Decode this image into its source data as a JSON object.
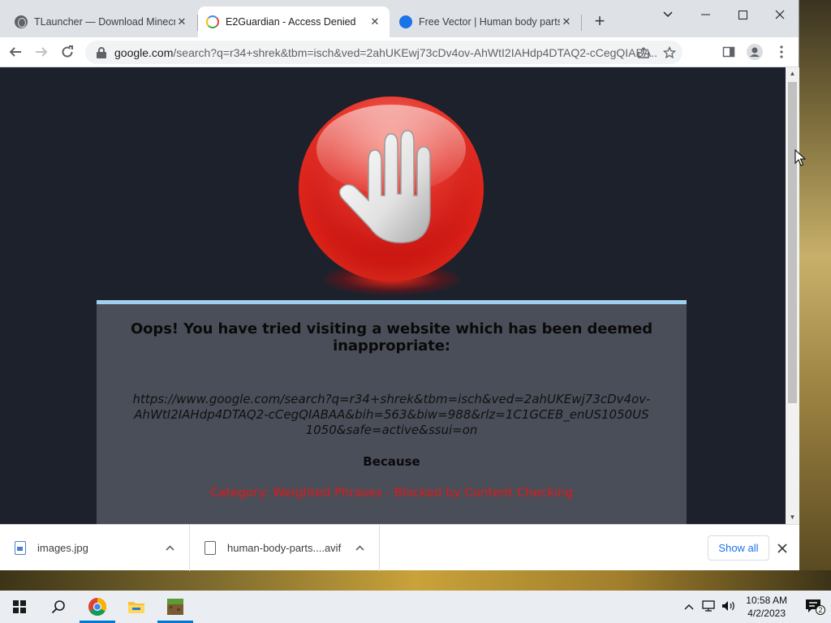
{
  "tabs": [
    {
      "title": "TLauncher — Download Minecraft",
      "favicon": "globe-icon",
      "active": false
    },
    {
      "title": "E2Guardian - Access Denied",
      "favicon": "google-g-icon",
      "active": true
    },
    {
      "title": "Free Vector | Human body parts",
      "favicon": "freepik-icon",
      "active": false
    }
  ],
  "window": {
    "minimize": "minimize-icon",
    "maximize": "maximize-icon",
    "close": "close-icon",
    "tab_search": "chevron-down-icon"
  },
  "omnibox": {
    "url_host": "google.com",
    "url_rest": "/search?q=r34+shrek&tbm=isch&ved=2ahUKEwj73cDv4ov-AhWtI2IAHdp4DTAQ2-cCegQIABA..."
  },
  "block_page": {
    "heading": "Oops! You have tried visiting a website which has been deemed inappropriate:",
    "blocked_url": "https://www.google.com/search?q=r34+shrek&tbm=isch&ved=2ahUKEwj73cDv4ov-AhWtI2IAHdp4DTAQ2-cCegQIABAA&bih=563&biw=988&rlz=1C1GCEB_enUS1050US1050&safe=active&ssui=on",
    "because_label": "Because",
    "category": "Category: Weighted Phrases - Blocked by Content Checking",
    "colors": {
      "background": "#1d212c",
      "panel": "#4a4e59",
      "panel_border": "#9fd0f0",
      "category_text": "#e01818"
    }
  },
  "downloads": {
    "items": [
      {
        "filename": "images.jpg",
        "icon": "image-file-icon"
      },
      {
        "filename": "human-body-parts....avif",
        "icon": "file-icon"
      }
    ],
    "show_all_label": "Show all"
  },
  "taskbar": {
    "apps": [
      "start-button",
      "search-icon",
      "chrome-icon",
      "file-explorer-icon",
      "minecraft-icon"
    ],
    "time": "10:58 AM",
    "date": "4/2/2023"
  },
  "accent_color": "#1a73e8"
}
